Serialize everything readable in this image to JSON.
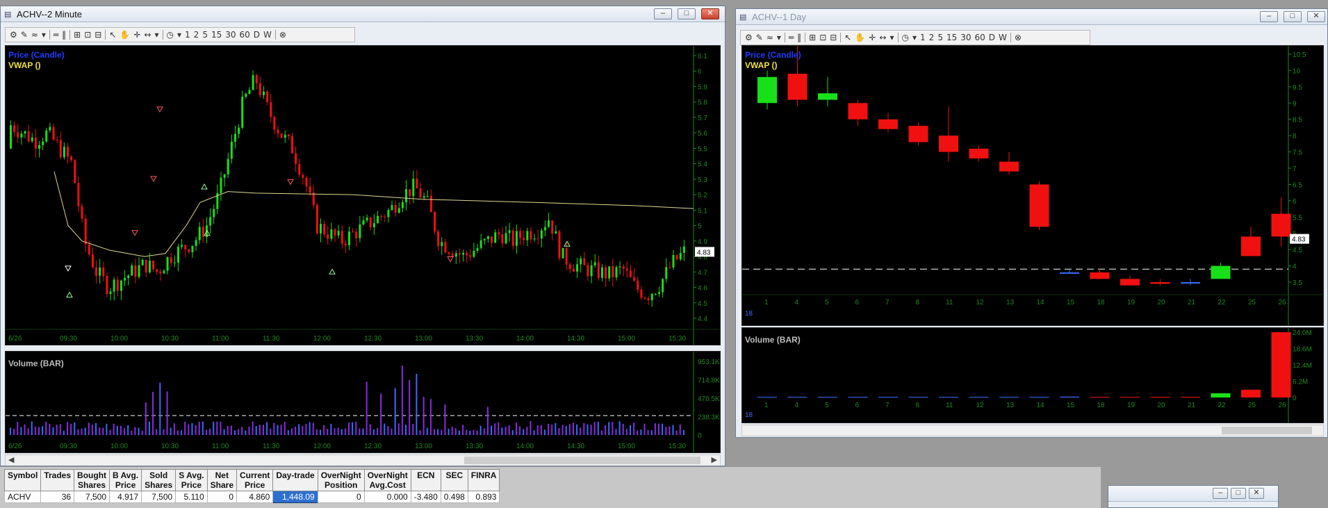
{
  "left_window": {
    "title": "ACHV--2 Minute",
    "toolbar": [
      "1",
      "2",
      "5",
      "15",
      "30",
      "60",
      "D",
      "W"
    ],
    "price_legend": "Price (Candle)",
    "vwap_legend": "VWAP ()",
    "volume_legend": "Volume (BAR)",
    "price_axis": [
      "6.1",
      "6",
      "5.9",
      "5.8",
      "5.7",
      "5.6",
      "5.5",
      "5.4",
      "5.3",
      "5.2",
      "5.1",
      "5",
      "4.9",
      "4.8",
      "4.7",
      "4.6",
      "4.5",
      "4.4"
    ],
    "last_price": "4.83",
    "time_axis": [
      "6/26",
      "09:30",
      "10:00",
      "10:30",
      "11:00",
      "11:30",
      "12:00",
      "12:30",
      "13:00",
      "13:30",
      "14:00",
      "14:30",
      "15:00",
      "15:30"
    ],
    "volume_axis": [
      "953.1K",
      "714.8K",
      "476.5K",
      "238.3K",
      "0"
    ]
  },
  "right_window": {
    "title": "ACHV--1 Day",
    "price_legend": "Price (Candle)",
    "vwap_legend": "VWAP ()",
    "volume_legend": "Volume (BAR)",
    "price_axis": [
      "10.5",
      "10",
      "9.5",
      "9",
      "8.5",
      "8",
      "7.5",
      "7",
      "6.5",
      "6",
      "5.5",
      "5",
      "4.5",
      "4",
      "3.5"
    ],
    "last_price": "4.83",
    "date_axis": [
      "1",
      "4",
      "5",
      "6",
      "7",
      "8",
      "11",
      "12",
      "13",
      "14",
      "15",
      "18",
      "19",
      "20",
      "21",
      "22",
      "25",
      "26"
    ],
    "marker": "18",
    "volume_axis": [
      "24.0M",
      "18.6M",
      "12.4M",
      "6.2M",
      "0"
    ]
  },
  "positions_table": {
    "headers": [
      [
        "Symbol",
        ""
      ],
      [
        "Trades",
        ""
      ],
      [
        "Bought",
        "Shares"
      ],
      [
        "B Avg.",
        "Price"
      ],
      [
        "Sold",
        "Shares"
      ],
      [
        "S Avg.",
        "Price"
      ],
      [
        "Net",
        "Share"
      ],
      [
        "Current",
        "Price"
      ],
      [
        "Day-trade",
        ""
      ],
      [
        "OverNight",
        "Position"
      ],
      [
        "OverNight",
        "Avg.Cost"
      ],
      [
        "ECN",
        ""
      ],
      [
        "SEC",
        ""
      ],
      [
        "FINRA",
        ""
      ]
    ],
    "row": [
      "ACHV",
      "36",
      "7,500",
      "4.917",
      "7,500",
      "5.110",
      "0",
      "4.860",
      "1,448.09",
      "0",
      "0.000",
      "-3.480",
      "0.498",
      "0.893"
    ]
  },
  "colors": {
    "up": "#18e018",
    "down": "#f01010",
    "vwap": "#e0d890",
    "axis": "#1f8a1f",
    "volume_purple": "#8a2be2",
    "volume_blue": "#3a6cff"
  }
}
